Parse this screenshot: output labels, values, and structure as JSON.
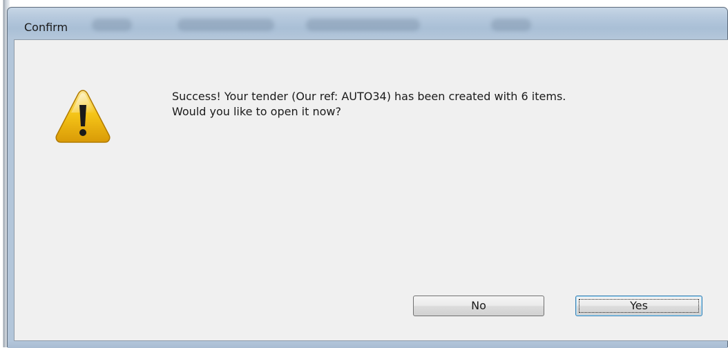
{
  "dialog": {
    "title": "Confirm",
    "message_line1": "Success! Your tender (Our ref: AUTO34) has been created with 6 items.",
    "message_line2": "Would you like to open it now?",
    "icon": "warning-icon"
  },
  "buttons": {
    "no_label": "No",
    "yes_label": "Yes"
  },
  "colors": {
    "dialog_bg": "#f0f0f0",
    "titlebar": "#b6c9dd",
    "warning_yellow": "#f5c518",
    "focus_border": "#3c7fb1"
  }
}
